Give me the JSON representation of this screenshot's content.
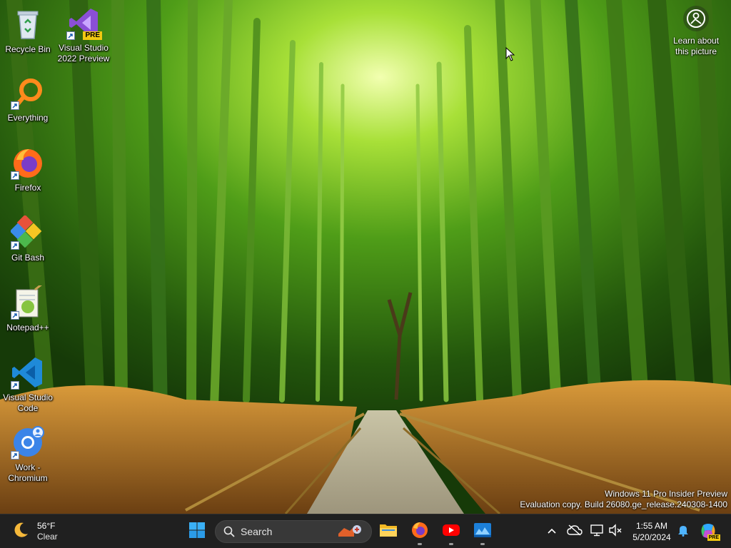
{
  "desktop": {
    "icons": [
      {
        "name": "recycle-bin",
        "label": "Recycle Bin"
      },
      {
        "name": "visual-studio-2022-preview",
        "label": "Visual Studio 2022 Preview",
        "badge": "PRE"
      },
      {
        "name": "everything",
        "label": "Everything"
      },
      {
        "name": "firefox",
        "label": "Firefox"
      },
      {
        "name": "git-bash",
        "label": "Git Bash"
      },
      {
        "name": "notepad-plus-plus",
        "label": "Notepad++"
      },
      {
        "name": "visual-studio-code",
        "label": "Visual Studio Code"
      },
      {
        "name": "work-chromium",
        "label": "Work - Chromium"
      }
    ],
    "learn_about": "Learn about this picture",
    "watermark": {
      "line1": "Windows 11 Pro Insider Preview",
      "line2": "Evaluation copy. Build 26080.ge_release.240308-1400"
    }
  },
  "taskbar": {
    "weather": {
      "temperature": "56°F",
      "condition": "Clear",
      "icon": "moon-icon"
    },
    "search_label": "Search",
    "pinned": [
      {
        "name": "start",
        "icon": "windows-logo-icon"
      },
      {
        "name": "file-explorer",
        "icon": "folder-icon"
      },
      {
        "name": "firefox",
        "icon": "firefox-icon",
        "running": true
      },
      {
        "name": "youtube",
        "icon": "youtube-icon",
        "running": true
      },
      {
        "name": "remote-desktop",
        "icon": "image-app-icon",
        "running": true
      }
    ],
    "tray": {
      "icons": [
        "chevron-up-icon",
        "onedrive-offline-icon",
        "network-icon",
        "volume-muted-icon",
        "notification-bell-icon",
        "copilot-icon"
      ],
      "copilot_badge": "PRE"
    },
    "clock": {
      "time": "1:55 AM",
      "date": "5/20/2024"
    }
  },
  "colors": {
    "taskbar": "#202020",
    "search_box": "#383838",
    "accent": "#0078d4"
  }
}
